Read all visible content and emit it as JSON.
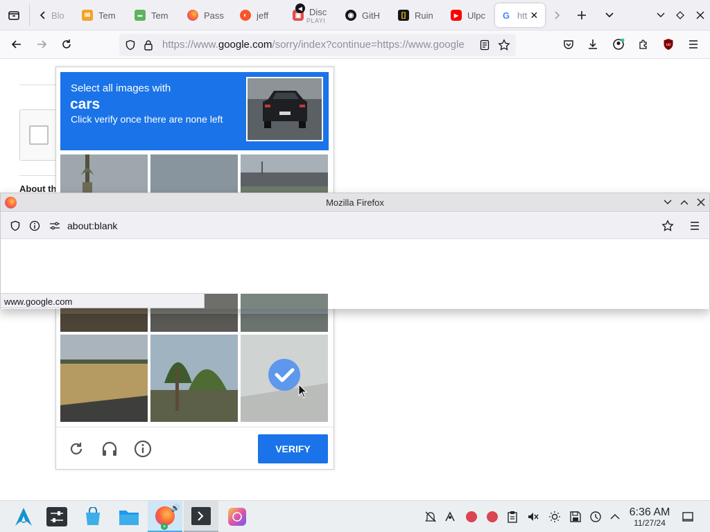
{
  "browser": {
    "tabs": [
      {
        "label": "Blo",
        "icon": "blog-icon"
      },
      {
        "label": "Tem",
        "icon": "mail-icon",
        "color": "#f4a227"
      },
      {
        "label": "Tem",
        "icon": "temp-mail-icon",
        "color": "#5fb35f"
      },
      {
        "label": "Pass",
        "icon": "firefox-icon"
      },
      {
        "label": "jeff",
        "icon": "brave-icon",
        "color": "#fb542b"
      },
      {
        "label": "Disc",
        "sub": "PLAYI",
        "icon": "discord-icon"
      },
      {
        "label": "GitH",
        "icon": "github-icon"
      },
      {
        "label": "Ruin",
        "icon": "ruin-icon"
      },
      {
        "label": "Ulpc",
        "icon": "youtube-icon",
        "color": "#ff0000"
      },
      {
        "label": "htt",
        "icon": "google-icon",
        "active": true
      }
    ],
    "url_prefix": "https://www.",
    "url_domain": "google.com",
    "url_rest": "/sorry/index?continue=https://www.google"
  },
  "page": {
    "about_heading": "About th"
  },
  "captcha": {
    "instruction": "Select all images with",
    "target": "cars",
    "hint": "Click verify once there are none left",
    "verify_label": "VERIFY",
    "colors": {
      "accent": "#1a73e8"
    },
    "tiles": [
      {
        "scene": "palm-tree-sky"
      },
      {
        "scene": "grey-sky"
      },
      {
        "scene": "overpass-road"
      },
      {
        "scene": "street-bottom"
      },
      {
        "scene": "street-bottom"
      },
      {
        "scene": "street-bottom"
      },
      {
        "scene": "dry-field"
      },
      {
        "scene": "palm-trees"
      },
      {
        "scene": "road-selected",
        "selected": true
      }
    ]
  },
  "popup": {
    "title": "Mozilla Firefox",
    "url": "about:blank",
    "status": "www.google.com"
  },
  "taskbar": {
    "time": "6:36 AM",
    "date": "11/27/24"
  }
}
